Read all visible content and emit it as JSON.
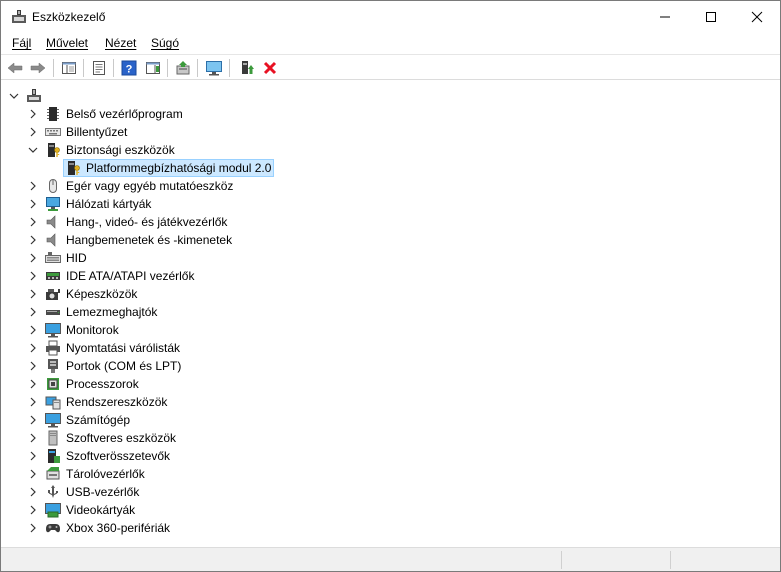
{
  "window": {
    "title": "Eszközkezelő"
  },
  "menu": [
    {
      "label": "Fájl"
    },
    {
      "label": "Művelet"
    },
    {
      "label": "Nézet"
    },
    {
      "label": "Súgó"
    }
  ],
  "toolbar": {
    "buttons": [
      "back-arrow-icon",
      "forward-arrow-icon",
      "show-hide-console-tree-icon",
      "properties-icon",
      "help-icon",
      "action-pane-icon",
      "update-driver-icon",
      "scan-hardware-icon",
      "enable-device-icon",
      "uninstall-device-icon"
    ]
  },
  "tree": {
    "root_icon": "computer-root-icon",
    "items": [
      {
        "label": "Belső vezérlőprogram",
        "icon": "firmware-icon",
        "expanded": false
      },
      {
        "label": "Billentyűzet",
        "icon": "keyboard-icon",
        "expanded": false
      },
      {
        "label": "Biztonsági eszközök",
        "icon": "security-device-icon",
        "expanded": true
      },
      {
        "label": "Platformmegbízhatósági modul 2.0",
        "icon": "tpm-icon",
        "child": true,
        "selected": true
      },
      {
        "label": "Egér vagy egyéb mutatóeszköz",
        "icon": "mouse-icon",
        "expanded": false
      },
      {
        "label": "Hálózati kártyák",
        "icon": "network-adapter-icon",
        "expanded": false
      },
      {
        "label": "Hang-, videó- és játékvezérlők",
        "icon": "speaker-icon",
        "expanded": false
      },
      {
        "label": "Hangbemenetek és -kimenetek",
        "icon": "speaker-icon",
        "expanded": false
      },
      {
        "label": "HID",
        "icon": "hid-icon",
        "expanded": false
      },
      {
        "label": "IDE ATA/ATAPI vezérlők",
        "icon": "ide-controller-icon",
        "expanded": false
      },
      {
        "label": "Képeszközök",
        "icon": "camera-icon",
        "expanded": false
      },
      {
        "label": "Lemezmeghajtók",
        "icon": "disk-drive-icon",
        "expanded": false
      },
      {
        "label": "Monitorok",
        "icon": "monitor-icon",
        "expanded": false
      },
      {
        "label": "Nyomtatási várólisták",
        "icon": "printer-icon",
        "expanded": false
      },
      {
        "label": "Portok (COM és LPT)",
        "icon": "port-icon",
        "expanded": false
      },
      {
        "label": "Processzorok",
        "icon": "processor-icon",
        "expanded": false
      },
      {
        "label": "Rendszereszközök",
        "icon": "system-device-icon",
        "expanded": false
      },
      {
        "label": "Számítógép",
        "icon": "computer-icon",
        "expanded": false
      },
      {
        "label": "Szoftveres eszközök",
        "icon": "software-device-icon",
        "expanded": false
      },
      {
        "label": "Szoftverösszetevők",
        "icon": "software-component-icon",
        "expanded": false
      },
      {
        "label": "Tárolóvezérlők",
        "icon": "storage-controller-icon",
        "expanded": false
      },
      {
        "label": "USB-vezérlők",
        "icon": "usb-icon",
        "expanded": false
      },
      {
        "label": "Videokártyák",
        "icon": "display-adapter-icon",
        "expanded": false
      },
      {
        "label": "Xbox 360-perifériák",
        "icon": "gamepad-icon",
        "expanded": false
      }
    ]
  },
  "colors": {
    "selection": "#cce8ff",
    "selection_border": "#99d1ff",
    "uninstall_red": "#e81123"
  }
}
